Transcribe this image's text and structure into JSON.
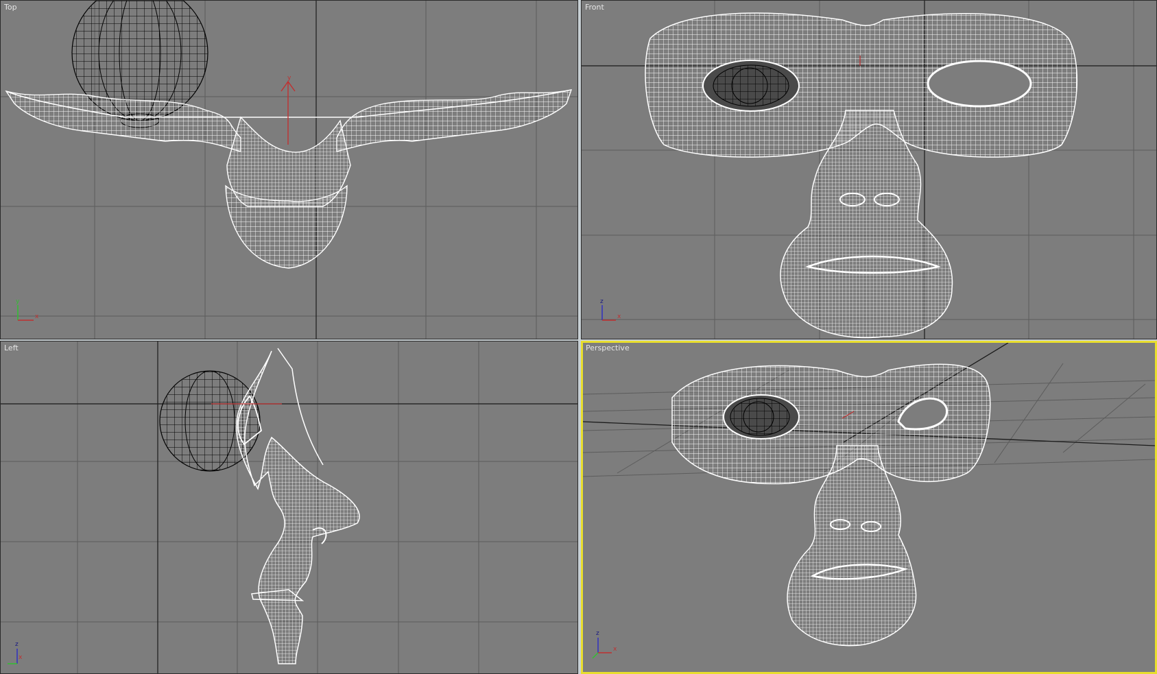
{
  "viewports": {
    "top": {
      "label": "Top",
      "axis_h": "x",
      "axis_v": "y"
    },
    "front": {
      "label": "Front",
      "axis_h": "x",
      "axis_v": "z"
    },
    "left": {
      "label": "Left",
      "axis_h": "x",
      "axis_v": "z"
    },
    "perspective": {
      "label": "Perspective",
      "axis_h": "x",
      "axis_v": "z",
      "active": true
    }
  },
  "colors": {
    "viewport_bg": "#7d7d7d",
    "grid_line": "#5c5c5c",
    "home_grid_line": "#1a1a1a",
    "mesh_wire": "#ffffff",
    "sphere_wire": "#000000",
    "active_border": "#e8de2e",
    "axis_x": "#c03030",
    "axis_y": "#30c030",
    "axis_z": "#3030c0"
  },
  "icons": {
    "top_gizmo": "axis-tripod-icon",
    "front_gizmo": "axis-tripod-icon",
    "left_gizmo": "axis-tripod-icon",
    "persp_gizmo": "axis-tripod-icon"
  }
}
